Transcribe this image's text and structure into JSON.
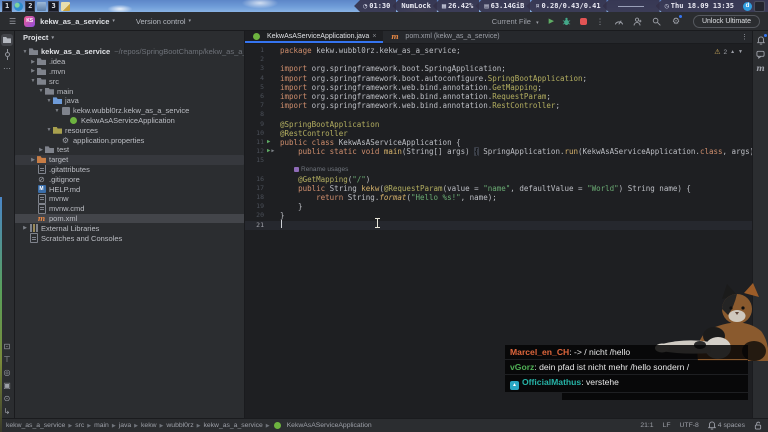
{
  "glyphs": {
    "hamburger": "☰",
    "chevron_down": "▾",
    "more_v": "⋮",
    "more_h": "⋯",
    "close": "×",
    "warning": "⚠"
  },
  "desktop_bar": {
    "workspaces": [
      {
        "n": "1",
        "icon": "globe-icon"
      },
      {
        "n": "2",
        "icon": "screen-icon"
      },
      {
        "n": "3",
        "icon": "notes-icon"
      }
    ],
    "segments": [
      {
        "icon": "timer",
        "text": "01:30"
      },
      {
        "icon": "",
        "text": "NumLock"
      },
      {
        "icon": "cpu",
        "text": "26.42%"
      },
      {
        "icon": "ram",
        "text": "63.14GiB"
      },
      {
        "icon": "load",
        "text": "0.28/0.43/0.41"
      },
      {
        "icon": "spark",
        "text": ""
      },
      {
        "icon": "clock",
        "text": "Thu 18.09 13:35"
      }
    ],
    "tray": [
      {
        "name": "messenger-icon",
        "letter": "d"
      },
      {
        "name": "display-icon",
        "letter": ""
      }
    ]
  },
  "titlebar": {
    "logo": "KS",
    "project": "kekw_as_a_service",
    "vcs_label": "Version control",
    "run_config": "Current File",
    "unlock_label": "Unlock Ultimate",
    "tools": [
      "profiler",
      "code-with-me",
      "search",
      "settings"
    ]
  },
  "left_stripe": {
    "top": [
      "project",
      "commit",
      "more"
    ],
    "bottom": [
      "terminal",
      "services",
      "run-dashboard",
      "build",
      "problems",
      "pull-requests"
    ]
  },
  "right_stripe": [
    "notifications",
    "ai-assistant",
    "maven"
  ],
  "project_panel": {
    "header": "Project",
    "tree": [
      {
        "d": 0,
        "ch": "v",
        "icon": "folder",
        "label": "kekw_as_a_service",
        "bold": true,
        "extra": "~/repos/SpringBootChamp/kekw_as_a_service"
      },
      {
        "d": 1,
        "ch": ">",
        "icon": "folder",
        "label": ".idea"
      },
      {
        "d": 1,
        "ch": ">",
        "icon": "folder",
        "label": ".mvn"
      },
      {
        "d": 1,
        "ch": "v",
        "icon": "folder",
        "label": "src"
      },
      {
        "d": 2,
        "ch": "v",
        "icon": "folder",
        "label": "main"
      },
      {
        "d": 3,
        "ch": "v",
        "icon": "folder-java",
        "label": "java"
      },
      {
        "d": 4,
        "ch": "v",
        "icon": "package",
        "label": "kekw.wubbl0rz.kekw_as_a_service"
      },
      {
        "d": 5,
        "ch": "",
        "icon": "spring",
        "label": "KekwAsAServiceApplication"
      },
      {
        "d": 3,
        "ch": "v",
        "icon": "folder-res",
        "label": "resources"
      },
      {
        "d": 4,
        "ch": "",
        "icon": "gear",
        "label": "application.properties"
      },
      {
        "d": 2,
        "ch": ">",
        "icon": "folder",
        "label": "test"
      },
      {
        "d": 1,
        "ch": ">",
        "icon": "folder-excl",
        "label": "target",
        "hl": true
      },
      {
        "d": 1,
        "ch": "",
        "icon": "file",
        "label": ".gitattributes"
      },
      {
        "d": 1,
        "ch": "",
        "icon": "ignore",
        "label": ".gitignore"
      },
      {
        "d": 1,
        "ch": "",
        "icon": "md",
        "label": "HELP.md"
      },
      {
        "d": 1,
        "ch": "",
        "icon": "file",
        "label": "mvnw"
      },
      {
        "d": 1,
        "ch": "",
        "icon": "file",
        "label": "mvnw.cmd"
      },
      {
        "d": 1,
        "ch": "",
        "icon": "maven",
        "label": "pom.xml",
        "sel": true
      },
      {
        "d": 0,
        "ch": ">",
        "icon": "lib",
        "label": "External Libraries"
      },
      {
        "d": 0,
        "ch": "",
        "icon": "scratch",
        "label": "Scratches and Consoles"
      }
    ]
  },
  "editor": {
    "tabs": [
      {
        "label": "KekwAsAServiceApplication.java",
        "icon": "spring",
        "close": true,
        "active": true
      },
      {
        "label": "pom.xml (kekw_as_a_service)",
        "icon": "maven",
        "active": false
      }
    ],
    "inspections": {
      "warning_count": "2"
    },
    "code": {
      "lines": [
        {
          "n": "1",
          "t": [
            [
              "kw",
              "package"
            ],
            [
              "d",
              " kekw.wubbl0rz.kekw_as_a_service;"
            ]
          ]
        },
        {
          "n": "2",
          "t": []
        },
        {
          "n": "3",
          "t": [
            [
              "kw",
              "import"
            ],
            [
              "d",
              " org.springframework.boot.SpringApplication;"
            ]
          ]
        },
        {
          "n": "4",
          "t": [
            [
              "kw",
              "import"
            ],
            [
              "d",
              " org.springframework.boot.autoconfigure."
            ],
            [
              "ann",
              "SpringBootApplication"
            ],
            [
              "d",
              ";"
            ]
          ]
        },
        {
          "n": "5",
          "t": [
            [
              "kw",
              "import"
            ],
            [
              "d",
              " org.springframework.web.bind.annotation."
            ],
            [
              "ann",
              "GetMapping"
            ],
            [
              "d",
              ";"
            ]
          ]
        },
        {
          "n": "6",
          "t": [
            [
              "kw",
              "import"
            ],
            [
              "d",
              " org.springframework.web.bind.annotation."
            ],
            [
              "ann",
              "RequestParam"
            ],
            [
              "d",
              ";"
            ]
          ]
        },
        {
          "n": "7",
          "t": [
            [
              "kw",
              "import"
            ],
            [
              "d",
              " org.springframework.web.bind.annotation."
            ],
            [
              "ann",
              "RestController"
            ],
            [
              "d",
              ";"
            ]
          ]
        },
        {
          "n": "8",
          "t": []
        },
        {
          "n": "9",
          "t": [
            [
              "ann",
              "@SpringBootApplication"
            ]
          ]
        },
        {
          "n": "10",
          "t": [
            [
              "ann",
              "@RestController"
            ]
          ]
        },
        {
          "n": "11",
          "g": "run",
          "t": [
            [
              "kw",
              "public class"
            ],
            [
              "d",
              " KekwAsAServiceApplication {"
            ]
          ]
        },
        {
          "n": "12",
          "g": "run fold",
          "t": [
            [
              "d",
              "    "
            ],
            [
              "kw",
              "public static void"
            ],
            [
              "d",
              " "
            ],
            [
              "mth",
              "main"
            ],
            [
              "d",
              "(String[] args) "
            ],
            [
              "hl",
              "{"
            ],
            [
              "d",
              " SpringApplication."
            ],
            [
              "mth",
              "run"
            ],
            [
              "d",
              "(KekwAsAServiceApplication."
            ],
            [
              "kw",
              "class"
            ],
            [
              "d",
              ", args); "
            ],
            [
              "hl",
              "}"
            ]
          ]
        },
        {
          "n": "15",
          "t": []
        },
        {
          "n": "",
          "inlay": "Rename usages",
          "t": []
        },
        {
          "n": "16",
          "t": [
            [
              "d",
              "    "
            ],
            [
              "ann",
              "@GetMapping"
            ],
            [
              "d",
              "("
            ],
            [
              "str",
              "\"/\""
            ],
            [
              "d",
              ")"
            ]
          ]
        },
        {
          "n": "17",
          "t": [
            [
              "d",
              "    "
            ],
            [
              "kw",
              "public"
            ],
            [
              "d",
              " String "
            ],
            [
              "mth",
              "kekw"
            ],
            [
              "d",
              "("
            ],
            [
              "ann",
              "@RequestParam"
            ],
            [
              "d",
              "(value = "
            ],
            [
              "str",
              "\"name\""
            ],
            [
              "d",
              ", defaultValue = "
            ],
            [
              "str",
              "\"World\""
            ],
            [
              "d",
              ") String name) {"
            ]
          ]
        },
        {
          "n": "18",
          "t": [
            [
              "d",
              "        "
            ],
            [
              "kw",
              "return"
            ],
            [
              "d",
              " String."
            ],
            [
              "mthi",
              "format"
            ],
            [
              "d",
              "("
            ],
            [
              "str",
              "\"Hello %s!\""
            ],
            [
              "d",
              ", name);"
            ]
          ]
        },
        {
          "n": "19",
          "t": [
            [
              "d",
              "    }"
            ]
          ]
        },
        {
          "n": "20",
          "t": [
            [
              "d",
              "}"
            ]
          ]
        },
        {
          "n": "21",
          "caret": true,
          "t": []
        }
      ]
    }
  },
  "status_bar": {
    "breadcrumbs": [
      "kekw_as_a_service",
      "src",
      "main",
      "java",
      "kekw",
      "wubbl0rz",
      "kekw_as_a_service"
    ],
    "breadcrumb_last": {
      "icon": "spring",
      "label": "KekwAsAServiceApplication"
    },
    "right": [
      {
        "text": "21:1"
      },
      {
        "text": "LF"
      },
      {
        "text": "UTF-8"
      },
      {
        "icon": "bell",
        "text": "4 spaces"
      },
      {
        "icon": "lock-open",
        "text": ""
      }
    ]
  },
  "chat": {
    "messages": [
      {
        "user": "Marcel_en_CH",
        "color": "#e0663c",
        "text": "-> / nicht /hello"
      },
      {
        "user": "vGorz",
        "color": "#4fae54",
        "text": "dein pfad ist nicht mehr /hello sondern /"
      },
      {
        "user": "OfficialMathus",
        "color": "#26b3a7",
        "badge": "sub-badge",
        "text": "verstehe"
      }
    ]
  },
  "colors": {
    "accent": "#3574f0",
    "run_green": "#5fad65",
    "stop_red": "#e25454",
    "spring_green": "#6db33f",
    "warning": "#d6b25e",
    "keyword": "#cf8e6d",
    "string": "#6aab73",
    "annotation": "#b3ae60",
    "method": "#d6b26b"
  }
}
